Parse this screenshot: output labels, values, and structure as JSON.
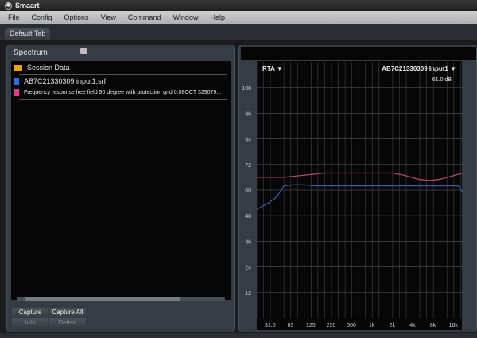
{
  "app": {
    "title": "Smaart"
  },
  "menu": [
    "File",
    "Config",
    "Options",
    "View",
    "Command",
    "Window",
    "Help"
  ],
  "tab": {
    "label": "Default Tab"
  },
  "left_panel": {
    "title": "Spectrum",
    "items": [
      {
        "label": "Session Data",
        "icon": "folder-icon",
        "color": "#e8a317"
      },
      {
        "label": "AB7C21330309 input1.srf",
        "icon": "file-icon",
        "color": "#2f6fd6"
      },
      {
        "label": "Frequency response free field 90 degree with  protection grid 0.08OCT 329079...",
        "icon": "file-icon",
        "color": "#d63c8c"
      }
    ],
    "buttons": {
      "capture": "Capture",
      "capture_all": "Capture All",
      "info": "Info",
      "delete": "Delete"
    }
  },
  "right_panel": {
    "mode": "RTA ▼",
    "input": "AB7C21330309 Input1 ▼",
    "level": "61.0 dB"
  },
  "chart_data": {
    "type": "line",
    "xscale": "log",
    "xlim": [
      20,
      22000
    ],
    "ylim": [
      0,
      120
    ],
    "grid": true,
    "yticks": [
      108,
      96,
      84,
      72,
      60,
      48,
      36,
      24,
      12
    ],
    "xticks": [
      {
        "v": 31.5,
        "l": "31.5"
      },
      {
        "v": 63,
        "l": "63"
      },
      {
        "v": 125,
        "l": "125"
      },
      {
        "v": 250,
        "l": "250"
      },
      {
        "v": 500,
        "l": "500"
      },
      {
        "v": 1000,
        "l": "1k"
      },
      {
        "v": 2000,
        "l": "2k"
      },
      {
        "v": 4000,
        "l": "4k"
      },
      {
        "v": 8000,
        "l": "8k"
      },
      {
        "v": 16000,
        "l": "16k"
      }
    ],
    "series": [
      {
        "color": "#b04a6a",
        "points": [
          [
            20,
            66
          ],
          [
            50,
            66
          ],
          [
            100,
            67
          ],
          [
            200,
            68
          ],
          [
            500,
            68
          ],
          [
            1000,
            68
          ],
          [
            2000,
            68
          ],
          [
            3000,
            67
          ],
          [
            5000,
            65
          ],
          [
            7000,
            64.5
          ],
          [
            10000,
            65
          ],
          [
            15000,
            66.5
          ],
          [
            22000,
            68
          ]
        ]
      },
      {
        "color": "#2f5fa0",
        "points": [
          [
            20,
            51
          ],
          [
            30,
            54
          ],
          [
            40,
            57
          ],
          [
            50,
            62
          ],
          [
            70,
            62.5
          ],
          [
            100,
            62.5
          ],
          [
            150,
            62
          ],
          [
            500,
            62
          ],
          [
            2000,
            62
          ],
          [
            10000,
            62
          ],
          [
            19000,
            62
          ],
          [
            22000,
            59
          ]
        ]
      }
    ]
  }
}
